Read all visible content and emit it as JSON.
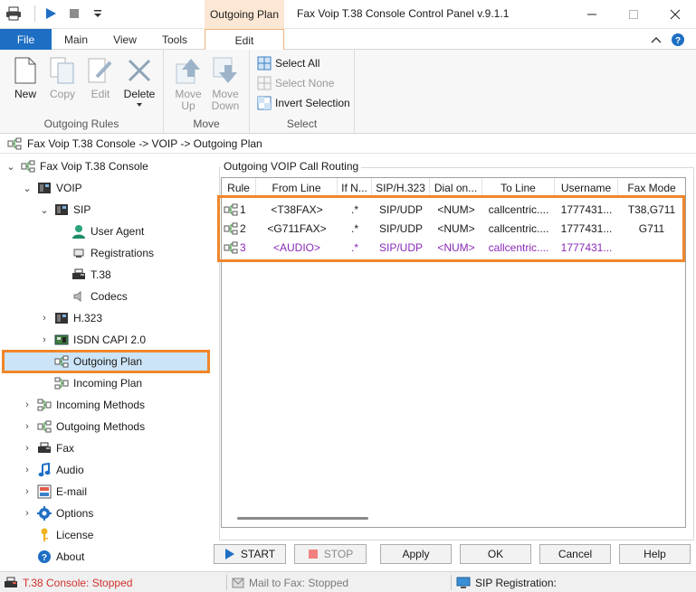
{
  "window": {
    "title": "Fax Voip T.38 Console Control Panel v.9.1.1",
    "context_tab": "Outgoing Plan"
  },
  "ribbon_tabs": {
    "file": "File",
    "main": "Main",
    "view": "View",
    "tools": "Tools",
    "edit": "Edit"
  },
  "ribbon": {
    "new": "New",
    "copy": "Copy",
    "edit": "Edit",
    "delete": "Delete",
    "move_up": "Move\nUp",
    "move_up_1": "Move",
    "move_up_2": "Up",
    "move_down_1": "Move",
    "move_down_2": "Down",
    "group_outgoing_rules": "Outgoing Rules",
    "group_move": "Move",
    "select_all": "Select All",
    "select_none": "Select None",
    "invert_selection": "Invert Selection",
    "group_select": "Select"
  },
  "breadcrumb": "Fax Voip T.38 Console -> VOIP -> Outgoing Plan",
  "tree": {
    "root": "Fax Voip T.38 Console",
    "voip": "VOIP",
    "sip": "SIP",
    "user_agent": "User Agent",
    "registrations": "Registrations",
    "t38": "T.38",
    "codecs": "Codecs",
    "h323": "H.323",
    "isdn": "ISDN CAPI 2.0",
    "outgoing_plan": "Outgoing Plan",
    "incoming_plan": "Incoming Plan",
    "incoming_methods": "Incoming Methods",
    "outgoing_methods": "Outgoing Methods",
    "fax": "Fax",
    "audio": "Audio",
    "email": "E-mail",
    "options": "Options",
    "license": "License",
    "about": "About"
  },
  "panel": {
    "group_title": "Outgoing VOIP Call Routing",
    "columns": [
      "Rule",
      "From Line",
      "If N...",
      "SIP/H.323",
      "Dial on...",
      "To Line",
      "Username",
      "Fax Mode"
    ],
    "rows": [
      {
        "rule": "1",
        "from_line": "<T38FAX>",
        "if_n": ".*",
        "protocol": "SIP/UDP",
        "dial_on": "<NUM>",
        "to_line": "callcentric....",
        "username": "1777431...",
        "fax_mode": "T38,G711"
      },
      {
        "rule": "2",
        "from_line": "<G711FAX>",
        "if_n": ".*",
        "protocol": "SIP/UDP",
        "dial_on": "<NUM>",
        "to_line": "callcentric....",
        "username": "1777431...",
        "fax_mode": "G711"
      },
      {
        "rule": "3",
        "from_line": "<AUDIO>",
        "if_n": ".*",
        "protocol": "SIP/UDP",
        "dial_on": "<NUM>",
        "to_line": "callcentric....",
        "username": "1777431...",
        "fax_mode": ""
      }
    ]
  },
  "buttons": {
    "start": "START",
    "stop": "STOP",
    "apply": "Apply",
    "ok": "OK",
    "cancel": "Cancel",
    "help": "Help"
  },
  "status": {
    "console": "T.38 Console: Stopped",
    "mail": "Mail to Fax: Stopped",
    "sip": "SIP Registration:"
  },
  "colors": {
    "accent": "#1e6fc4",
    "highlight": "#f0862a",
    "selection": "#cce4f7",
    "status_error": "#d0312d",
    "purple_row": "#8a2ab8"
  }
}
